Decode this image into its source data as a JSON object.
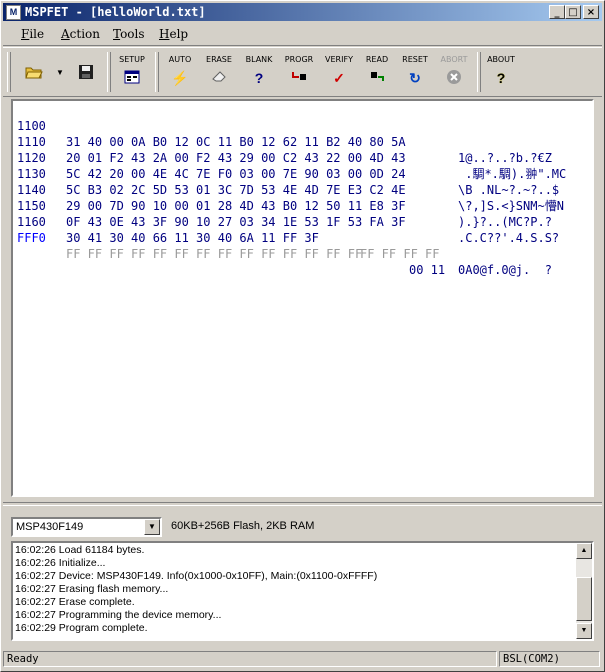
{
  "window": {
    "title": "MSPFET - [helloWorld.txt]"
  },
  "menu": [
    "File",
    "Action",
    "Tools",
    "Help"
  ],
  "toolbar": {
    "tools": [
      {
        "label": "SETUP"
      },
      {
        "label": "AUTO"
      },
      {
        "label": "ERASE"
      },
      {
        "label": "BLANK"
      },
      {
        "label": "PROGR"
      },
      {
        "label": "VERIFY"
      },
      {
        "label": "READ"
      },
      {
        "label": "RESET"
      },
      {
        "label": "ABORT"
      },
      {
        "label": "ABOUT"
      }
    ]
  },
  "hex": {
    "rows": [
      {
        "addr": "1100",
        "bytes": "31 40 00 0A B0 12 0C 11 B0 12 62 11 B2 40 80 5A",
        "ascii": "1@..?..?b.?€Z"
      },
      {
        "addr": "1110",
        "bytes": "20 01 F2 43 2A 00 F2 43 29 00 C2 43 22 00 4D 43",
        "ascii": " .騆*.騆).翀\".MC"
      },
      {
        "addr": "1120",
        "bytes": "5C 42 20 00 4E 4C 7E F0 03 00 7E 90 03 00 0D 24",
        "ascii": "\\B .NL~?.~?..$"
      },
      {
        "addr": "1130",
        "bytes": "5C B3 02 2C 5D 53 01 3C 7D 53 4E 4D 7E E3 C2 4E",
        "ascii": "\\?,]S.<}SNM~懵N"
      },
      {
        "addr": "1140",
        "bytes": "29 00 7D 90 10 00 01 28 4D 43 B0 12 50 11 E8 3F",
        "ascii": ").}?..(MC?P.?"
      },
      {
        "addr": "1150",
        "bytes": "0F 43 0E 43 3F 90 10 27 03 34 1E 53 1F 53 FA 3F",
        "ascii": ".C.C??'.4.S.S?"
      },
      {
        "addr": "1160",
        "bytes": "30 41 30 40 66 11 30 40 6A 11 FF 3F",
        "dimbytes": "FF FF FF FF",
        "ascii": "0A0@f.0@j.  ?"
      },
      {
        "addr": "FFF0",
        "dimbytes": "FF FF FF FF FF FF FF FF FF FF FF FF FF FF",
        "bytes2": "00 11",
        "ascii": ""
      }
    ]
  },
  "device": {
    "selected": "MSP430F149",
    "info": "60KB+256B Flash, 2KB RAM"
  },
  "log": [
    "16:02:26 Load 61184 bytes.",
    "16:02:26 Initialize...",
    "16:02:27 Device: MSP430F149. Info(0x1000-0x10FF), Main:(0x1100-0xFFFF)",
    "16:02:27 Erasing flash memory...",
    "16:02:27 Erase complete.",
    "16:02:27 Programming the device memory...",
    "16:02:29 Program complete."
  ],
  "status": {
    "left": "Ready",
    "right": "BSL(COM2)"
  }
}
